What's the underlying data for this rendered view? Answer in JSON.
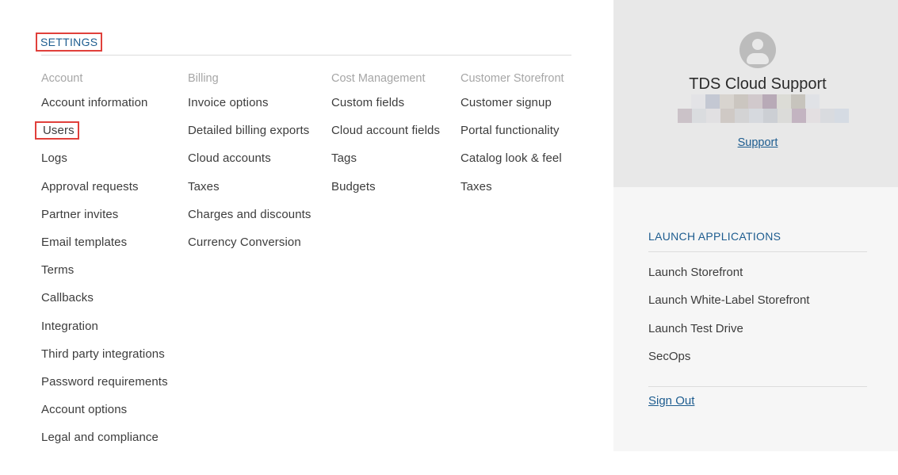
{
  "settings": {
    "title": "SETTINGS",
    "columns": [
      {
        "heading": "Account",
        "items": [
          "Account information",
          "Users",
          "Logs",
          "Approval requests",
          "Partner invites",
          "Email templates",
          "Terms",
          "Callbacks",
          "Integration",
          "Third party integrations",
          "Password requirements",
          "Account options",
          "Legal and compliance"
        ]
      },
      {
        "heading": "Billing",
        "items": [
          "Invoice options",
          "Detailed billing exports",
          "Cloud accounts",
          "Taxes",
          "Charges and discounts",
          "Currency Conversion"
        ]
      },
      {
        "heading": "Cost Management",
        "items": [
          "Custom fields",
          "Cloud account fields",
          "Tags",
          "Budgets"
        ]
      },
      {
        "heading": "Customer Storefront",
        "items": [
          "Customer signup",
          "Portal functionality",
          "Catalog look & feel",
          "Taxes"
        ]
      }
    ]
  },
  "profile": {
    "name": "TDS Cloud Support",
    "support_link": "Support",
    "avatar_icon": "user-circle-icon"
  },
  "launch": {
    "title": "LAUNCH APPLICATIONS",
    "items": [
      "Launch Storefront",
      "Launch White-Label Storefront",
      "Launch Test Drive",
      "SecOps"
    ],
    "sign_out": "Sign Out"
  },
  "colors": {
    "accent": "#1d5c8f",
    "highlight_border": "#e0403b"
  }
}
